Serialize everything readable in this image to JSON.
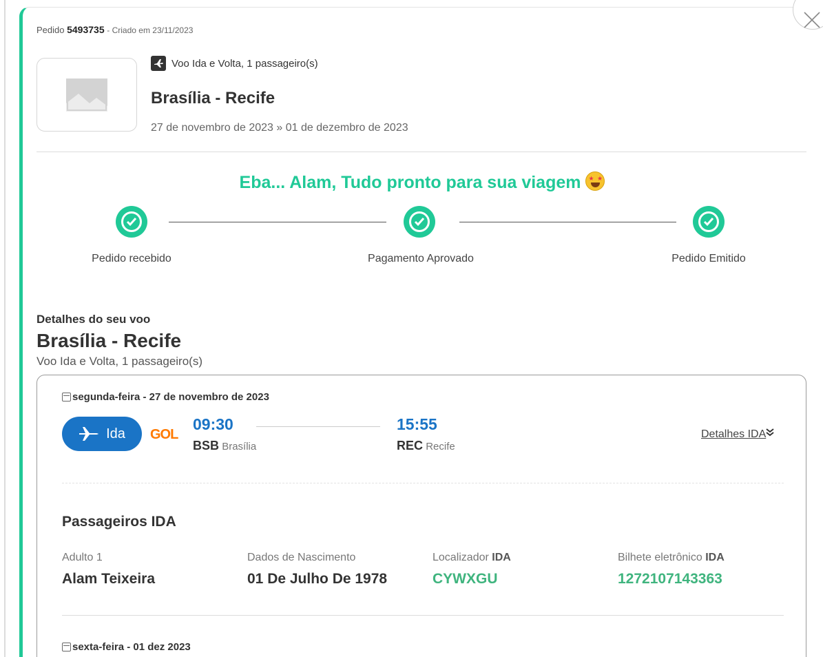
{
  "order": {
    "prefix": "Pedido",
    "number": "5493735",
    "created": "- Criado em 23/11/2023"
  },
  "summary": {
    "trip_type": "Voo Ida e Volta, 1 passageiro(s)",
    "route": "Brasília - Recife",
    "dates": "27 de novembro de 2023  »  01 de dezembro de 2023"
  },
  "status": {
    "message": "Eba... Alam, Tudo pronto para sua viagem",
    "steps": [
      {
        "label": "Pedido recebido"
      },
      {
        "label": "Pagamento Aprovado"
      },
      {
        "label": "Pedido Emitido"
      }
    ],
    "color": "#20c997"
  },
  "details": {
    "heading": "Detalhes do seu voo",
    "route": "Brasília - Recife",
    "subtitle": "Voo Ida e Volta, 1 passageiro(s)"
  },
  "outbound": {
    "date": "segunda-feira - 27 de novembro de 2023",
    "direction_label": "Ida",
    "airline": "GOL",
    "depart_time": "09:30",
    "depart_code": "BSB",
    "depart_city": "Brasília",
    "arrive_time": "15:55",
    "arrive_code": "REC",
    "arrive_city": "Recife",
    "details_link": "Detalhes IDA"
  },
  "passengers": {
    "title": "Passageiros IDA",
    "columns": [
      {
        "label": "Adulto 1",
        "label_bold": "",
        "value": "Alam Teixeira",
        "highlight": false
      },
      {
        "label": "Dados de Nascimento",
        "label_bold": "",
        "value": "01 De Julho De 1978",
        "highlight": false
      },
      {
        "label": "Localizador ",
        "label_bold": "IDA",
        "value": "CYWXGU",
        "highlight": true
      },
      {
        "label": "Bilhete eletrônico ",
        "label_bold": "IDA",
        "value": "1272107143363",
        "highlight": true
      }
    ]
  },
  "return": {
    "date": "sexta-feira - 01 dez 2023"
  },
  "colors": {
    "accent": "#20c997",
    "primary_blue": "#1a74c6",
    "airline_orange": "#ff7a00",
    "locator_green": "#3fb47e"
  }
}
